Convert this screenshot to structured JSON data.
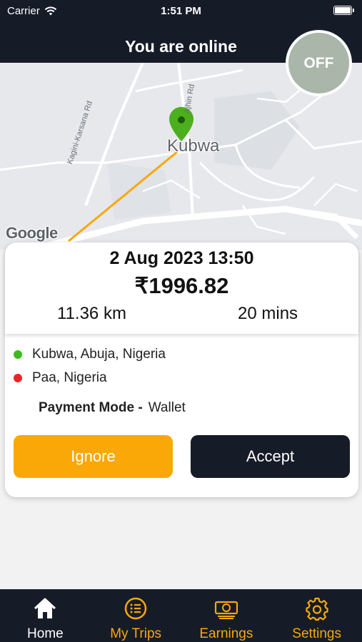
{
  "status_bar": {
    "carrier": "Carrier",
    "time": "1:51 PM"
  },
  "header": {
    "title": "You are online"
  },
  "toggle": {
    "label": "OFF"
  },
  "map": {
    "place_label": "Kubwa",
    "road_label_1": "Kagini-Karsana Rd",
    "road_label_2": "Ajhin Rd",
    "attribution": "Google",
    "route_color": "#f9a807",
    "pin_color": "#4caf1e"
  },
  "ride_request": {
    "date_time": "2 Aug 2023 13:50",
    "fare": "₹1996.82",
    "distance": "11.36 km",
    "duration": "20 mins",
    "pickup": "Kubwa, Abuja, Nigeria",
    "dropoff": "Paa, Nigeria",
    "payment_label": "Payment Mode -",
    "payment_value": "Wallet",
    "ignore_label": "Ignore",
    "accept_label": "Accept"
  },
  "colors": {
    "accent": "#f9a807",
    "dark": "#161b28",
    "pickup_dot": "#3dbb1d",
    "dropoff_dot": "#e8262a"
  },
  "nav": {
    "home": "Home",
    "my_trips": "My Trips",
    "earnings": "Earnings",
    "settings": "Settings"
  }
}
